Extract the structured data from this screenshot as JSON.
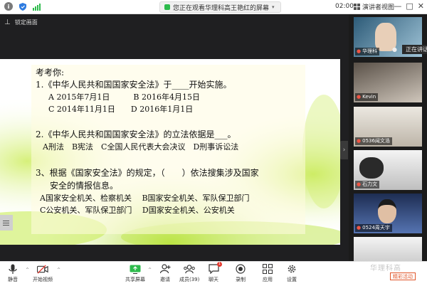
{
  "window": {
    "share_text": "您正在观看华理科高王艳红的屏幕",
    "time": "02:00",
    "view_label": "演讲者视图",
    "controls": [
      "—",
      "□",
      "✕"
    ]
  },
  "lock_label": "锁定画面",
  "slide": {
    "title": "考考你:",
    "q1": "1.《中华人民共和国国家安全法》于____开始实施。",
    "q1_ab": "A 2015年7月1日　　　B 2016年4月15日",
    "q1_cd": "C 2014年11月1日　　D 2016年1月1日",
    "q2": "2.《中华人民共和国国家安全法》的立法依据是___。",
    "q2_opts": "A刑法　B宪法　C全国人民代表大会决议　D刑事诉讼法",
    "q3_l1": "3、根据《国家安全法》的规定，（　　）依法搜集涉及国家",
    "q3_l2": "安全的情报信息。",
    "q3_ab": "A国家安全机关、检察机关　 B国家安全机关、军队保卫部门",
    "q3_cd": "C公安机关、军队保卫部门　 D国家安全机关、公安机关"
  },
  "participants": [
    {
      "name": "华理科",
      "colors": [
        "#3a6e8f",
        "#9fc3d6"
      ]
    },
    {
      "name": "Kevin",
      "colors": [
        "#6b6259",
        "#cfc6bb"
      ]
    },
    {
      "name": "0536闻文浩",
      "colors": [
        "#c9c2b6",
        "#ece8e1"
      ]
    },
    {
      "name": "石力文",
      "colors": [
        "#f2f2f2",
        "#bfbfbf"
      ]
    },
    {
      "name": "0524周天宇",
      "colors": [
        "#1d2d52",
        "#5574b2"
      ]
    },
    {
      "name": "",
      "colors": [
        "#d9d9d9",
        "#f4f4f4"
      ]
    }
  ],
  "speaking_label": "正在讲话",
  "toolbar": {
    "mute": "静音",
    "video": "开始视频",
    "share": "共享屏幕",
    "invite": "邀请",
    "members": "成员(39)",
    "chat": "聊天",
    "chat_badge": "1",
    "record": "录制",
    "apps": "应用",
    "settings": "设置"
  },
  "watermark": {
    "text": "华理科高",
    "badge": "精彩活动"
  },
  "colors": {
    "accent_green": "#2dbb4c",
    "shield_blue": "#2e7be0",
    "dark_bg": "#1f1f21",
    "badge_red": "#e5392f"
  }
}
